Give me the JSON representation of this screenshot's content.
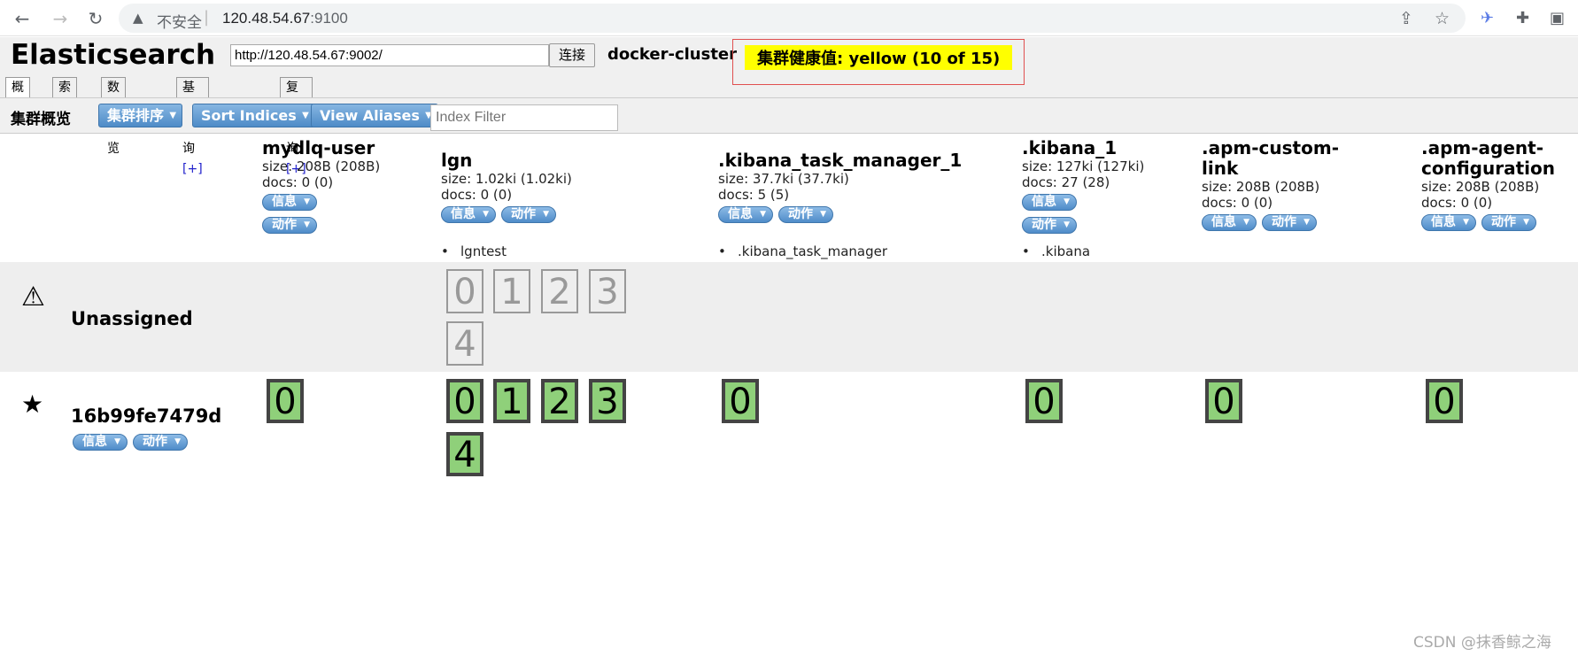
{
  "browser": {
    "insecure_label": "不安全",
    "url_host": "120.48.54.67",
    "url_port": ":9100"
  },
  "app": {
    "title": "Elasticsearch",
    "connect_url": "http://120.48.54.67:9002/",
    "connect_button": "连接",
    "cluster_name": "docker-cluster",
    "health": "集群健康值: yellow (10 of 15)",
    "health_color": "#ffff00"
  },
  "tabs": [
    {
      "label": "概览"
    },
    {
      "label": "索引"
    },
    {
      "label": "数据浏览"
    },
    {
      "label": "基本查询",
      "plus": "[+]"
    },
    {
      "label": "复合查询",
      "plus": "[+]"
    }
  ],
  "toolbar": {
    "title": "集群概览",
    "sort_cluster": "集群排序",
    "sort_indices": "Sort Indices",
    "view_aliases": "View Aliases",
    "index_filter_placeholder": "Index Filter"
  },
  "pill_labels": {
    "info": "信息",
    "action": "动作"
  },
  "indices": [
    {
      "name": "mydlq-user",
      "size": "size: 208B (208B)",
      "docs": "docs: 0 (0)",
      "alias": ""
    },
    {
      "name": "lgn",
      "size": "size: 1.02ki (1.02ki)",
      "docs": "docs: 0 (0)",
      "alias": "lgntest"
    },
    {
      "name": ".kibana_task_manager_1",
      "size": "size: 37.7ki (37.7ki)",
      "docs": "docs: 5 (5)",
      "alias": ".kibana_task_manager"
    },
    {
      "name": ".kibana_1",
      "size": "size: 127ki (127ki)",
      "docs": "docs: 27 (28)",
      "alias": ".kibana"
    },
    {
      "name": ".apm-custom-link",
      "size": "size: 208B (208B)",
      "docs": "docs: 0 (0)",
      "alias": ""
    },
    {
      "name": ".apm-agent-configuration",
      "size": "size: 208B (208B)",
      "docs": "docs: 0 (0)",
      "alias": ""
    }
  ],
  "rows": {
    "unassigned_label": "Unassigned",
    "node_name": "16b99fe7479d"
  },
  "shards": {
    "unassigned": [
      "0",
      "1",
      "2",
      "3",
      "4"
    ],
    "node_lgn": [
      "0",
      "1",
      "2",
      "3",
      "4"
    ],
    "node_single": "0"
  },
  "watermark": "CSDN @抹香鲸之海"
}
